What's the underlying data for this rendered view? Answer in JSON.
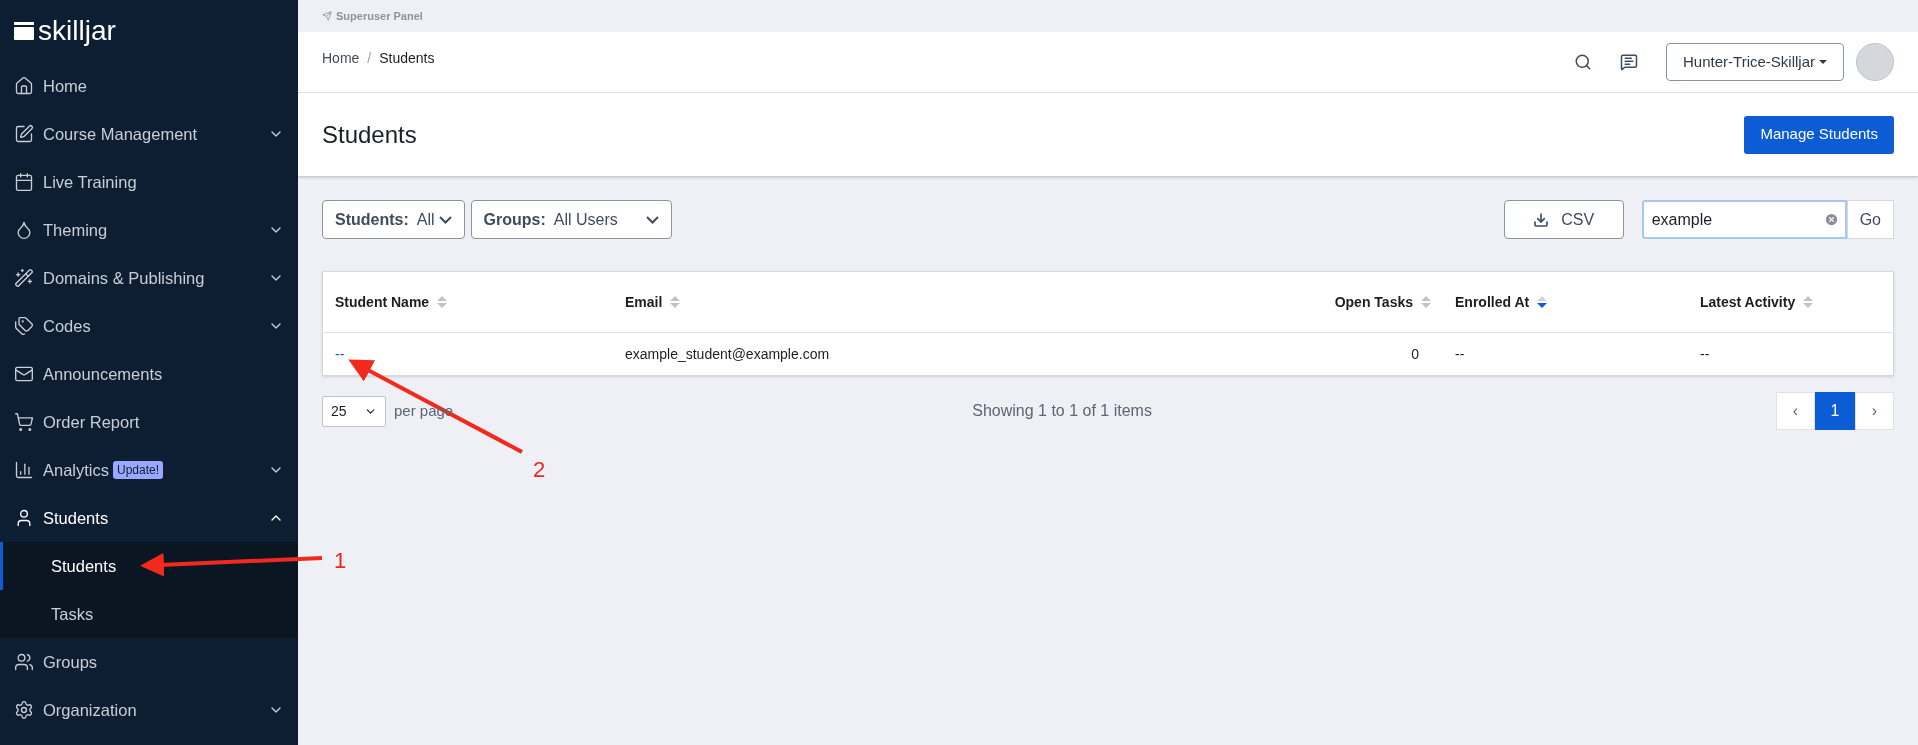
{
  "superuser_bar": {
    "label": "Superuser Panel"
  },
  "sidebar": {
    "logo": "skilljar",
    "items": [
      {
        "label": "Home",
        "expandable": false,
        "expanded": false
      },
      {
        "label": "Course Management",
        "expandable": true,
        "expanded": false
      },
      {
        "label": "Live Training",
        "expandable": false,
        "expanded": false
      },
      {
        "label": "Theming",
        "expandable": true,
        "expanded": false
      },
      {
        "label": "Domains & Publishing",
        "expandable": true,
        "expanded": false
      },
      {
        "label": "Codes",
        "expandable": true,
        "expanded": false
      },
      {
        "label": "Announcements",
        "expandable": false,
        "expanded": false
      },
      {
        "label": "Order Report",
        "expandable": false,
        "expanded": false
      },
      {
        "label": "Analytics",
        "badge": "Update!",
        "expandable": true,
        "expanded": false
      },
      {
        "label": "Students",
        "expandable": true,
        "expanded": true,
        "children": [
          {
            "label": "Students",
            "selected": true
          },
          {
            "label": "Tasks",
            "selected": false
          }
        ]
      },
      {
        "label": "Groups",
        "expandable": false,
        "expanded": false
      },
      {
        "label": "Organization",
        "expandable": true,
        "expanded": false
      }
    ]
  },
  "breadcrumb": [
    {
      "label": "Home",
      "link": true
    },
    {
      "separator": "/",
      "label": "Students",
      "link": false
    }
  ],
  "account_menu": {
    "label": "Hunter-Trice-Skilljar"
  },
  "page": {
    "title": "Students",
    "primary_button": "Manage Students"
  },
  "filters": [
    {
      "label": "Students:",
      "value": "All"
    },
    {
      "label": "Groups:",
      "value": "All Users"
    }
  ],
  "csv_button": "CSV",
  "search": {
    "value": "example",
    "go_button": "Go"
  },
  "table": {
    "columns": [
      {
        "label": "Student Name",
        "sorted": false
      },
      {
        "label": "Email",
        "sorted": false
      },
      {
        "label": "Open Tasks",
        "sorted": false
      },
      {
        "label": "Enrolled At",
        "sorted": true
      },
      {
        "label": "Latest Activity",
        "sorted": false
      }
    ],
    "rows": [
      {
        "cells": [
          "--",
          "example_student@example.com",
          "0",
          "--",
          "--"
        ]
      }
    ]
  },
  "pagination": {
    "per_page": "25",
    "per_page_label": "per page",
    "summary": "Showing 1 to 1 of 1 items",
    "prev": "‹",
    "next": "›",
    "pages": [
      {
        "label": "1",
        "selected": true
      }
    ]
  },
  "annotations": [
    {
      "label": "1"
    },
    {
      "label": "2"
    }
  ]
}
